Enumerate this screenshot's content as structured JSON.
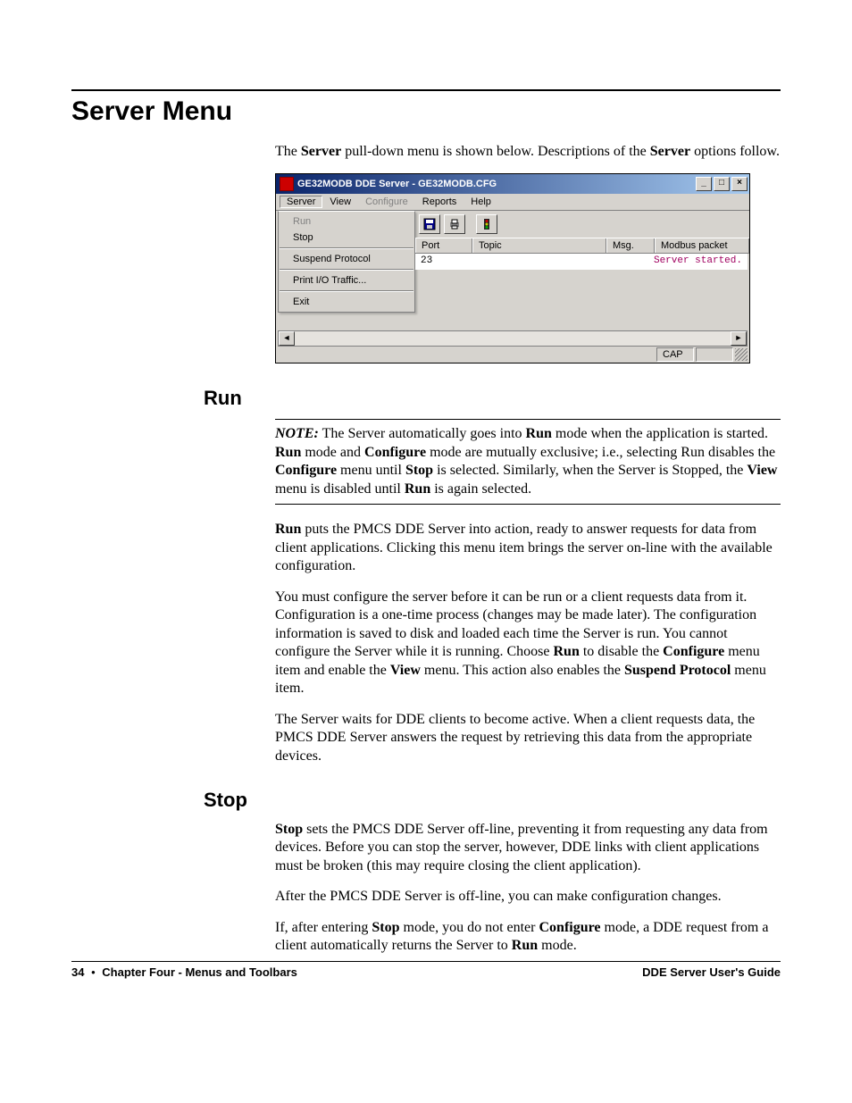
{
  "heading": "Server Menu",
  "intro": {
    "pre1": "The ",
    "b1": "Server",
    "mid1": " pull-down menu is shown below. Descriptions of the ",
    "b2": "Server",
    "post1": " options follow."
  },
  "app": {
    "title": "GE32MODB DDE Server - GE32MODB.CFG",
    "winbtn_min": "_",
    "winbtn_max": "□",
    "winbtn_close": "×",
    "menus": {
      "server": "Server",
      "view": "View",
      "configure": "Configure",
      "reports": "Reports",
      "help": "Help"
    },
    "dropdown": {
      "run": "Run",
      "stop": "Stop",
      "suspend": "Suspend Protocol",
      "print": "Print I/O Traffic...",
      "exit": "Exit"
    },
    "toolbar_icons": {
      "save": "save-icon",
      "print": "print-icon",
      "traffic": "traffic-light-icon"
    },
    "columns": {
      "port": "Port",
      "topic": "Topic",
      "msg": "Msg.",
      "modbus": "Modbus packet"
    },
    "row": {
      "frag": "23",
      "msg": "Server started."
    },
    "status": {
      "cap": "CAP"
    },
    "scroll": {
      "left": "◄",
      "right": "►"
    }
  },
  "run": {
    "heading": "Run",
    "note": {
      "label": "NOTE:",
      "t1": " The Server automatically goes into ",
      "b1": "Run",
      "t2": " mode when the application is started. ",
      "b2": "Run",
      "t3": " mode and ",
      "b3": "Configure",
      "t4": " mode are mutually exclusive; i.e., selecting Run disables the ",
      "b4": "Configure",
      "t5": " menu until ",
      "b5": "Stop",
      "t6": " is selected. Similarly, when the Server is Stopped, the ",
      "b6": "View",
      "t7": " menu is disabled until ",
      "b7": "Run",
      "t8": " is again selected."
    },
    "p1": {
      "b1": "Run",
      "t1": " puts the PMCS DDE Server into action, ready to answer requests for data from client applications. Clicking this menu item brings the server on-line with the available configuration."
    },
    "p2": {
      "t1": "You must configure the server before it can be run or a client requests data from it. Configuration is a one-time process (changes may be made later). The configuration information is saved to disk and loaded each time the Server is run. You cannot configure the Server while it is running. Choose ",
      "b1": "Run",
      "t2": " to disable the ",
      "b2": "Configure",
      "t3": " menu item and enable the ",
      "b3": "View",
      "t4": " menu. This action also enables the ",
      "b4": "Suspend Protocol",
      "t5": " menu item."
    },
    "p3": "The Server waits for DDE clients to become active. When a client requests data, the PMCS DDE Server answers the request by retrieving this data from the appropriate devices."
  },
  "stop": {
    "heading": "Stop",
    "p1": {
      "b1": "Stop",
      "t1": " sets the PMCS DDE Server off-line, preventing it from requesting any data from devices. Before you can stop the server, however, DDE links with client applications must be broken (this may require closing the client application)."
    },
    "p2": "After the PMCS DDE Server is off-line, you can make configuration changes.",
    "p3": {
      "t1": "If, after entering ",
      "b1": "Stop",
      "t2": " mode, you do not enter ",
      "b2": "Configure",
      "t3": " mode, a DDE request from a client automatically returns the Server to ",
      "b3": "Run",
      "t4": " mode."
    }
  },
  "footer": {
    "page": "34",
    "bullet": "•",
    "chapter": "Chapter Four - Menus and Toolbars",
    "book": "DDE Server User's Guide"
  }
}
